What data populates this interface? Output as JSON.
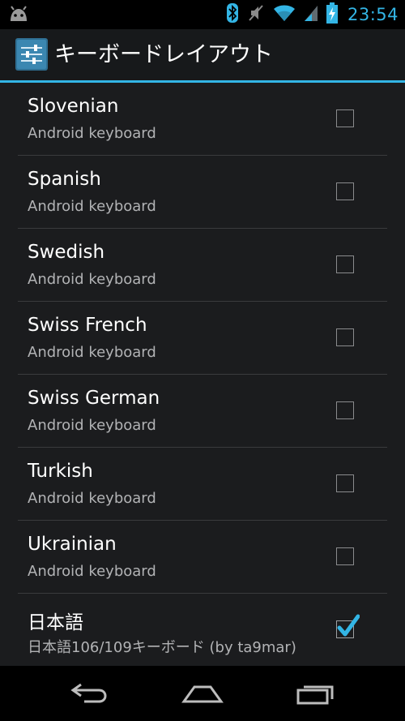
{
  "status_bar": {
    "time": "23:54",
    "icons": [
      "android-icon",
      "bluetooth-icon",
      "mute-icon",
      "wifi-icon",
      "signal-icon",
      "battery-charging-icon"
    ]
  },
  "action_bar": {
    "icon": "settings-sliders-icon",
    "title": "キーボードレイアウト"
  },
  "items": [
    {
      "title": "Slovenian",
      "summary": "Android keyboard",
      "checked": false
    },
    {
      "title": "Spanish",
      "summary": "Android keyboard",
      "checked": false
    },
    {
      "title": "Swedish",
      "summary": "Android keyboard",
      "checked": false
    },
    {
      "title": "Swiss French",
      "summary": "Android keyboard",
      "checked": false
    },
    {
      "title": "Swiss German",
      "summary": "Android keyboard",
      "checked": false
    },
    {
      "title": "Turkish",
      "summary": "Android keyboard",
      "checked": false
    },
    {
      "title": "Ukrainian",
      "summary": "Android keyboard",
      "checked": false
    },
    {
      "title": "日本語",
      "summary": "日本語106/109キーボード (by ta9mar)",
      "checked": true
    }
  ],
  "nav_bar": {
    "icons": [
      "back-icon",
      "home-icon",
      "recents-icon"
    ]
  },
  "colors": {
    "accent": "#33b5e5",
    "background": "#1b1c1e",
    "divider": "#3a3b3d",
    "summary_text": "#b2b3b5"
  }
}
